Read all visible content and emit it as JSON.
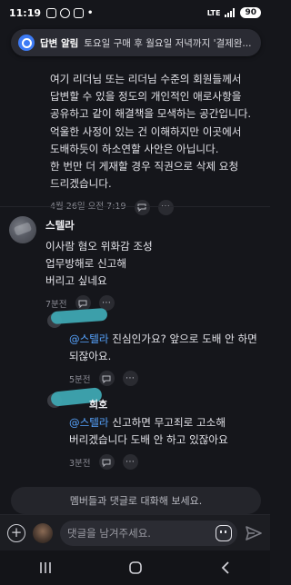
{
  "status_bar": {
    "time": "11:19",
    "network": "LTE",
    "battery": "90"
  },
  "notification": {
    "app": "답변 알림",
    "message": "토요일 구매 후 월요일 저녁까지 '결제완..."
  },
  "post": {
    "lines": [
      "여기 리더님 또는 리더님 수준의 회원들께서",
      "답변할 수 있을 정도의 개인적인 애로사항을",
      "공유하고 같이 해결책을 모색하는 공간입니다.",
      "억울한 사정이 있는 건 이해하지만 이곳에서",
      "도배하듯이 하소연할 사안은 아닙니다.",
      "한 번만 더 게재할 경우 직권으로 삭제 요청",
      "드리겠습니다."
    ],
    "timestamp": "4월 26일 오전 7:19"
  },
  "comments": [
    {
      "author": "스텔라",
      "lines": [
        "이사람   혐오 위화감 조성",
        "업무방해로 신고해",
        "버리고 싶네요"
      ],
      "timestamp": "7분전"
    }
  ],
  "replies": [
    {
      "author_visible": "",
      "mention": "@스텔라",
      "line1": " 진심인가요? 앞으로 도배 안 하면",
      "line2": "되잖아요.",
      "timestamp": "5분전"
    },
    {
      "author_visible": "희호",
      "mention": "@스텔라",
      "line1": " 신고하면 무고죄로 고소해",
      "line2": "버리겠습니다 도배 안 하고 있잖아요",
      "timestamp": "3분전"
    }
  ],
  "join_prompt": "멤버들과 댓글로 대화해 보세요.",
  "comment_input": {
    "placeholder": "댓글을 남겨주세요."
  },
  "icons": [
    "plus-icon",
    "sticker-icon",
    "send-icon",
    "more-icon",
    "comment-icon"
  ],
  "colors": {
    "background": "#15161b",
    "mention": "#57a4ff",
    "accent": "#3d7bf5"
  }
}
